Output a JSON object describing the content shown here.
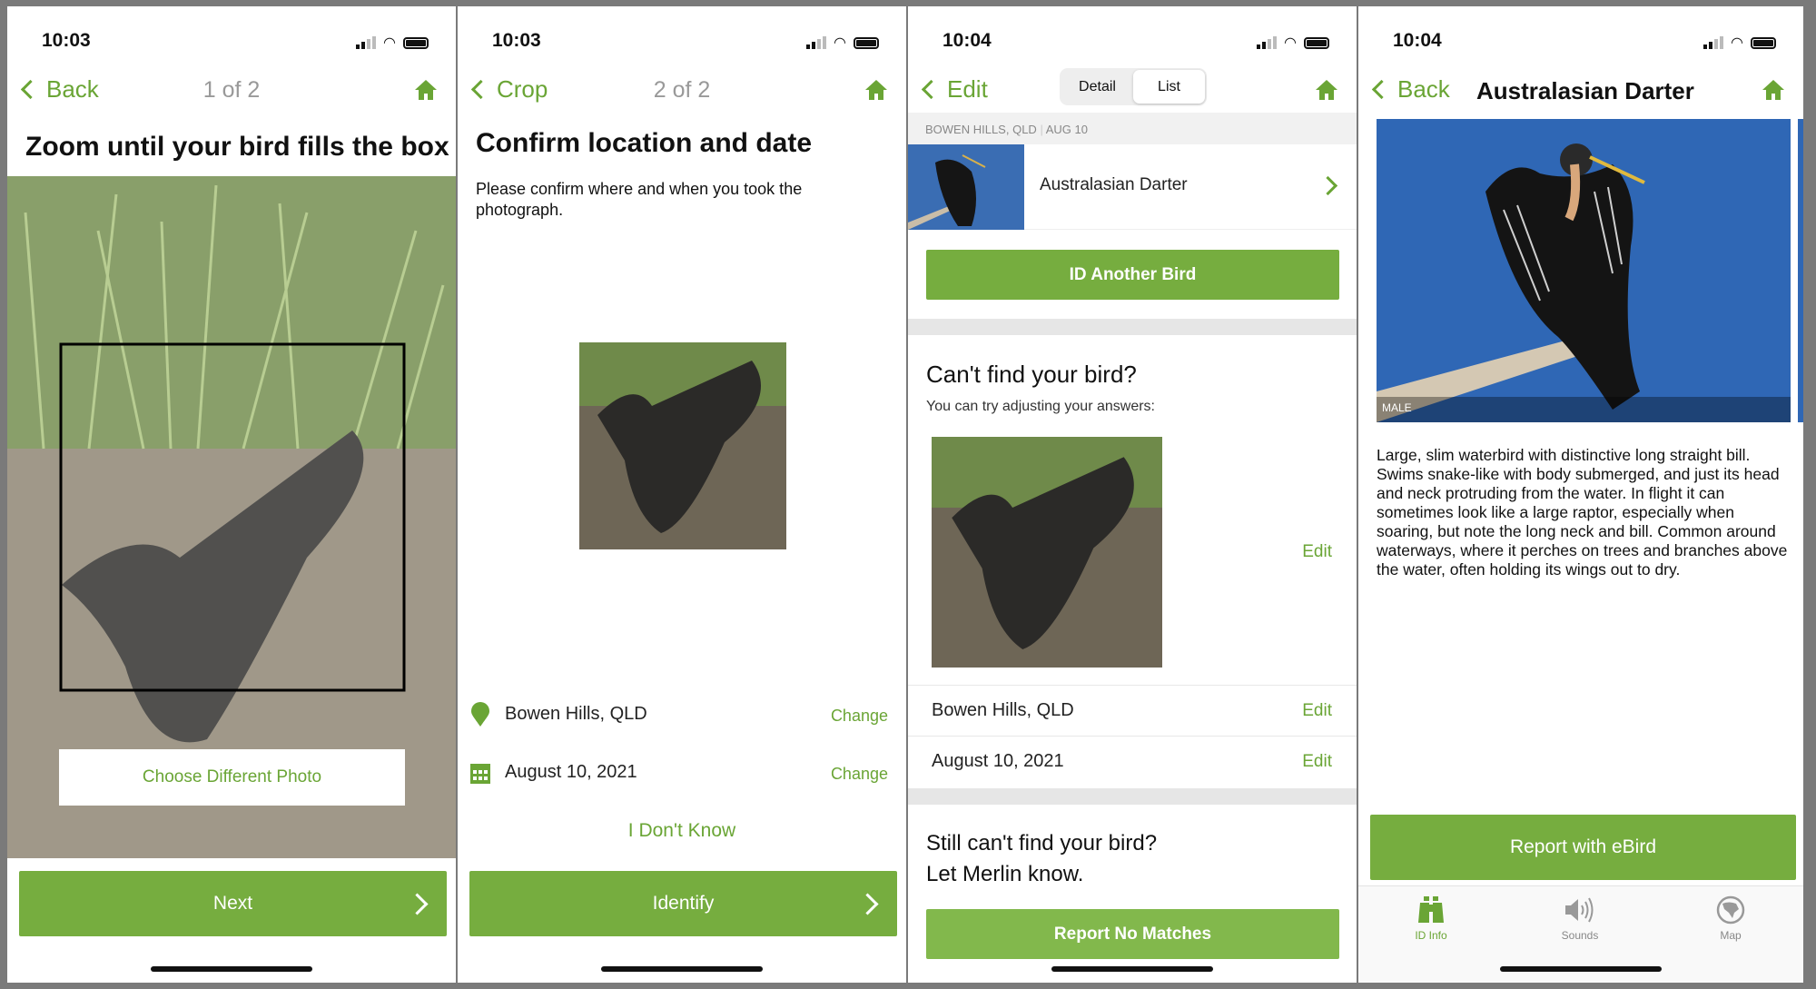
{
  "colors": {
    "accent": "#6aa535",
    "button": "#76ad3f",
    "button_light": "#82b84c"
  },
  "screens": [
    {
      "time": "10:03",
      "nav": {
        "back": "Back",
        "center": "1 of 2"
      },
      "title": "Zoom until your bird fills the box",
      "choose_photo": "Choose Different Photo",
      "primary": "Next"
    },
    {
      "time": "10:03",
      "nav": {
        "back": "Crop",
        "center": "2 of 2"
      },
      "title": "Confirm location and date",
      "description": "Please confirm where and when you took the photograph.",
      "location": "Bowen Hills, QLD",
      "date": "August 10, 2021",
      "change": "Change",
      "dont_know": "I Don't Know",
      "primary": "Identify"
    },
    {
      "time": "10:04",
      "nav": {
        "back": "Edit",
        "segments": [
          "Detail",
          "List"
        ],
        "selected": "List"
      },
      "header": {
        "place": "BOWEN HILLS, QLD",
        "date": "AUG 10"
      },
      "result": "Australasian Darter",
      "id_another": "ID Another Bird",
      "cant_find": "Can't find your bird?",
      "adjust": "You can try adjusting your answers:",
      "edit": "Edit",
      "location": "Bowen Hills, QLD",
      "date": "August 10, 2021",
      "still_line1": "Still can't find your bird?",
      "still_line2": "Let Merlin know.",
      "report_no_matches": "Report No Matches"
    },
    {
      "time": "10:04",
      "nav": {
        "back": "Back",
        "title": "Australasian Darter"
      },
      "photo_label": "MALE",
      "description": "Large, slim waterbird with distinctive long straight bill. Swims snake-like with body submerged, and just its head and neck protruding from the water. In flight it can sometimes look like a large raptor, especially when soaring, but note the long neck and bill. Common around waterways, where it perches on trees and branches above the water, often holding its wings out to dry.",
      "report": "Report with eBird",
      "tabs": [
        {
          "label": "ID Info",
          "icon": "binoculars-icon",
          "active": true
        },
        {
          "label": "Sounds",
          "icon": "speaker-icon"
        },
        {
          "label": "Map",
          "icon": "globe-icon"
        }
      ]
    }
  ]
}
